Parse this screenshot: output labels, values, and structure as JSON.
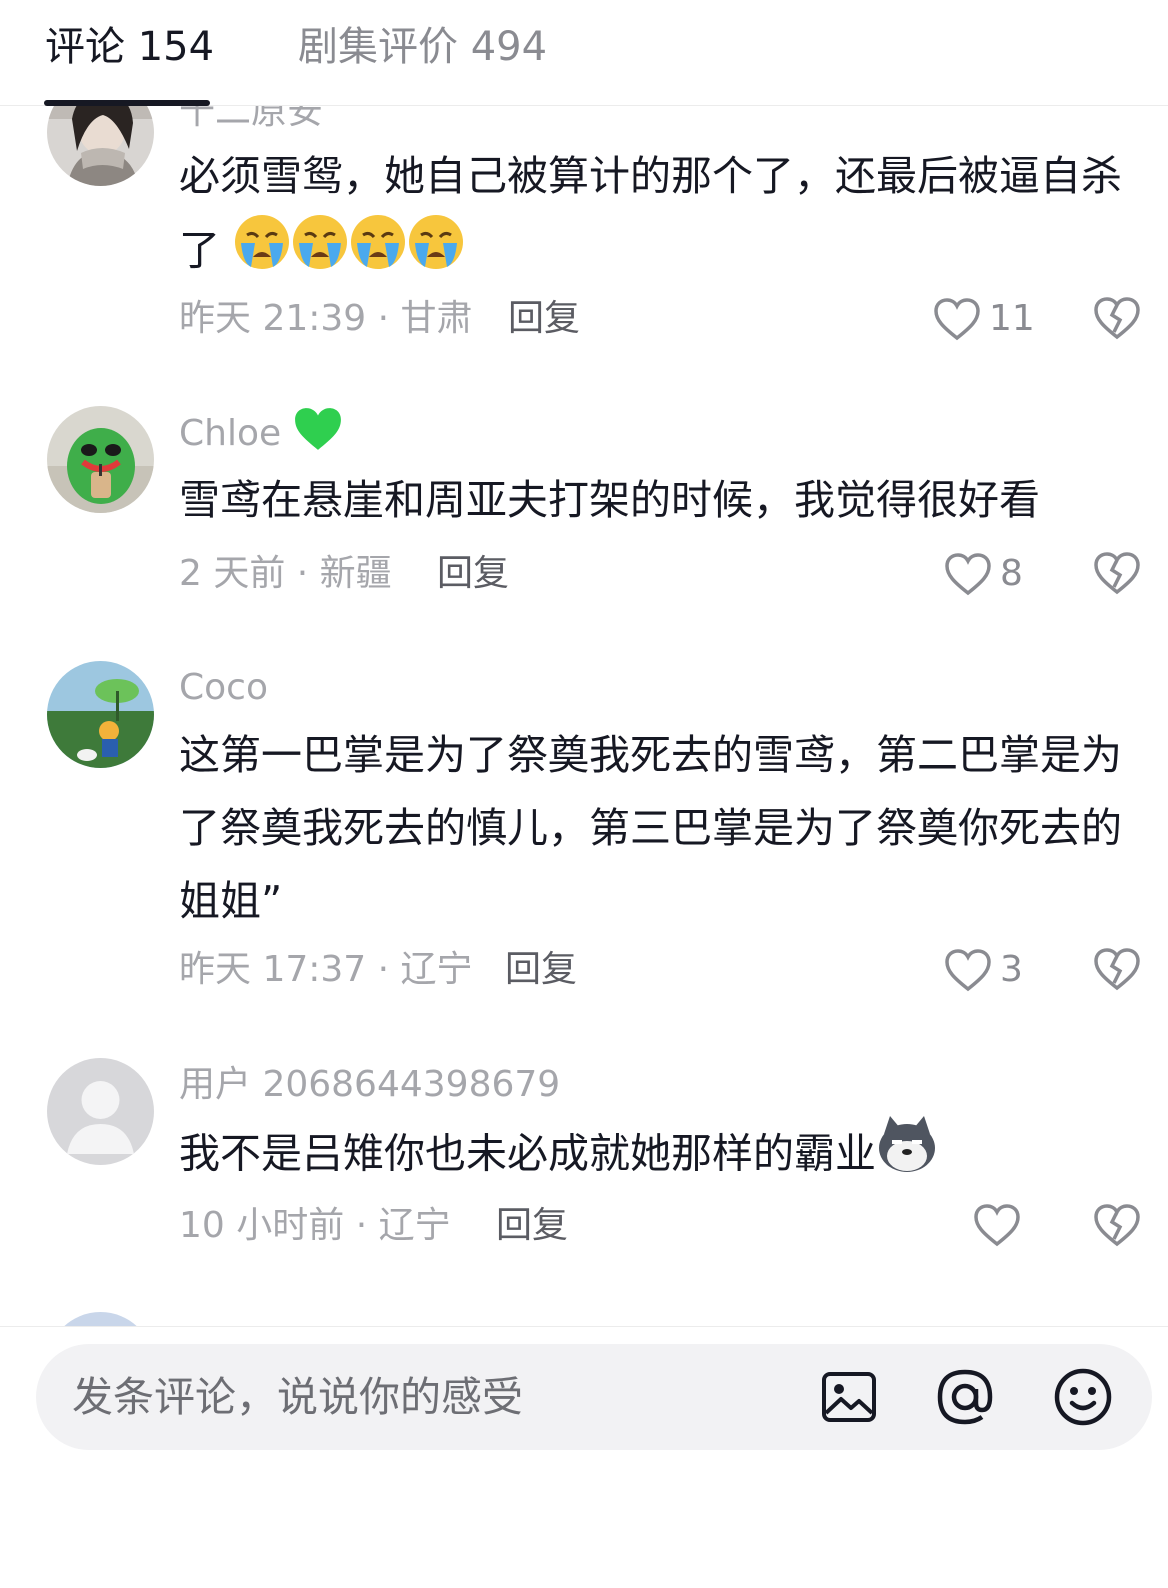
{
  "tabs": [
    {
      "label": "评论 154",
      "active": true
    },
    {
      "label": "剧集评价 494",
      "active": false
    }
  ],
  "comments": [
    {
      "username": "十二原安",
      "content": "必须雪鸳，她自己被算计的那个了，还最后被逼自杀了",
      "content_emoji": [
        "crying-emoji",
        "crying-emoji",
        "crying-emoji",
        "crying-emoji"
      ],
      "time_location": "昨天 21:39 · 甘肃",
      "reply": "回复",
      "likes": "11"
    },
    {
      "username": "Chloe",
      "username_emoji": "green-heart-emoji",
      "content": "雪鸢在悬崖和周亚夫打架的时候，我觉得很好看",
      "time_location": "2 天前 · 新疆",
      "reply": "回复",
      "likes": "8"
    },
    {
      "username": "Coco",
      "content": "这第一巴掌是为了祭奠我死去的雪鸢，第二巴掌是为了祭奠我死去的慎儿，第三巴掌是为了祭奠你死去的姐姐”",
      "time_location": "昨天 17:37 · 辽宁",
      "reply": "回复",
      "likes": "3"
    },
    {
      "username": "用户 2068644398679",
      "content": "我不是吕雉你也未必成就她那样的霸业",
      "content_emoji": [
        "husky-emoji"
      ],
      "time_location": "10 小时前 · 辽宁",
      "reply": "回复",
      "likes": ""
    }
  ],
  "composer": {
    "placeholder": "发条评论，说说你的感受",
    "icons": [
      "image-icon",
      "at-icon",
      "emoji-icon"
    ]
  },
  "colors": {
    "primary_text": "#161823",
    "secondary_text": "#a5a6ab",
    "composer_bg": "#f2f2f4"
  }
}
